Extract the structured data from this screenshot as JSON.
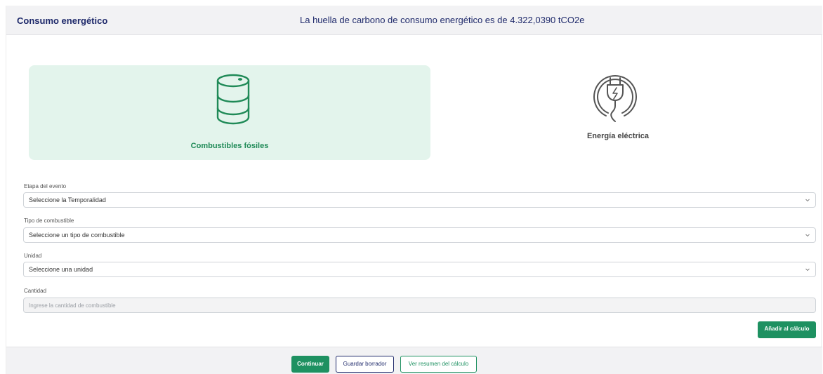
{
  "header": {
    "title": "Consumo energético",
    "footprint_text": "La huella de carbono de consumo energético es de 4.322,0390 tCO2e"
  },
  "categories": [
    {
      "label": "Combustibles fósiles",
      "icon": "fuel-barrel-icon",
      "selected": true
    },
    {
      "label": "Energía eléctrica",
      "icon": "electric-plug-icon",
      "selected": false
    }
  ],
  "form": {
    "stage": {
      "label": "Etapa del evento",
      "value": "Seleccione la Temporalidad"
    },
    "fuel_type": {
      "label": "Tipo de combustible",
      "value": "Seleccione un tipo de combustible"
    },
    "unit": {
      "label": "Unidad",
      "value": "Seleccione una unidad"
    },
    "quantity": {
      "label": "Cantidad",
      "value": "",
      "placeholder": "Ingrese la cantidad de combustible"
    },
    "add_label": "Añadir al cálculo"
  },
  "footer": {
    "continue_label": "Continuar",
    "draft_label": "Guardar borrador",
    "summary_label": "Ver resumen del cálculo"
  },
  "colors": {
    "accent_green": "#1e9161",
    "navy": "#1f2a6b",
    "selected_tile_bg": "#e3f4ec"
  }
}
